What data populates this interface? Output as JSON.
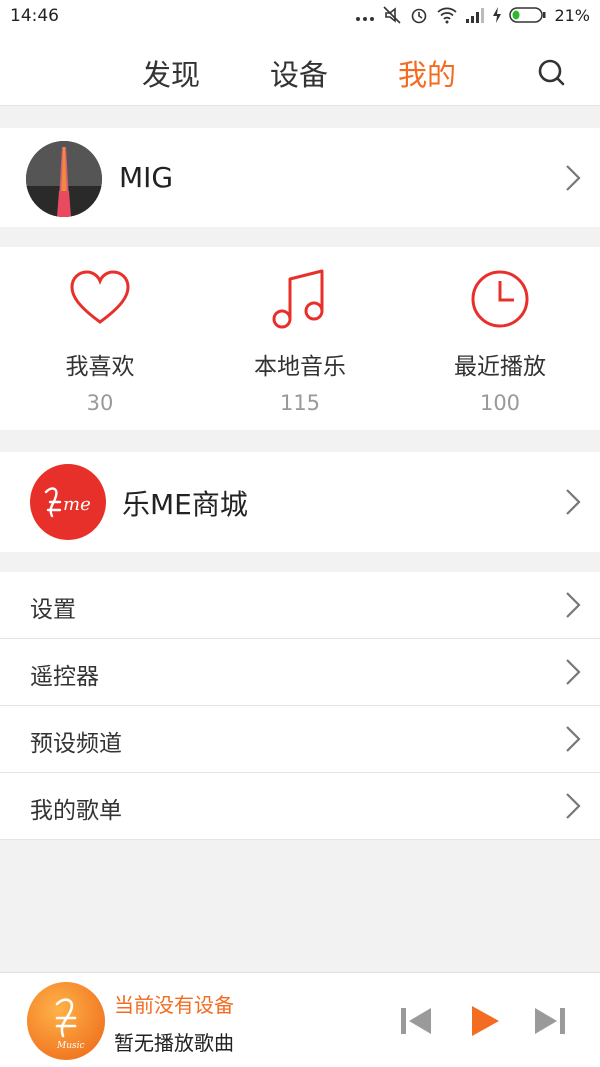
{
  "status_bar": {
    "time": "14:46",
    "battery": "21%"
  },
  "nav": {
    "tabs": [
      {
        "label": "发现",
        "active": false
      },
      {
        "label": "设备",
        "active": false
      },
      {
        "label": "我的",
        "active": true
      }
    ]
  },
  "profile": {
    "name": "MIG"
  },
  "stats": [
    {
      "label": "我喜欢",
      "count": "30",
      "icon": "heart-icon"
    },
    {
      "label": "本地音乐",
      "count": "115",
      "icon": "music-note-icon"
    },
    {
      "label": "最近播放",
      "count": "100",
      "icon": "clock-icon"
    }
  ],
  "shop": {
    "label": "乐ME商城",
    "logo_text": "me"
  },
  "menu": [
    {
      "label": "设置"
    },
    {
      "label": "遥控器"
    },
    {
      "label": "预设频道"
    },
    {
      "label": "我的歌单"
    }
  ],
  "player": {
    "status": "当前没有设备",
    "song": "暂无播放歌曲",
    "art_text": "Music"
  },
  "colors": {
    "accent": "#f36c21",
    "icon_red": "#e8302a",
    "background": "#f2f2f2"
  }
}
